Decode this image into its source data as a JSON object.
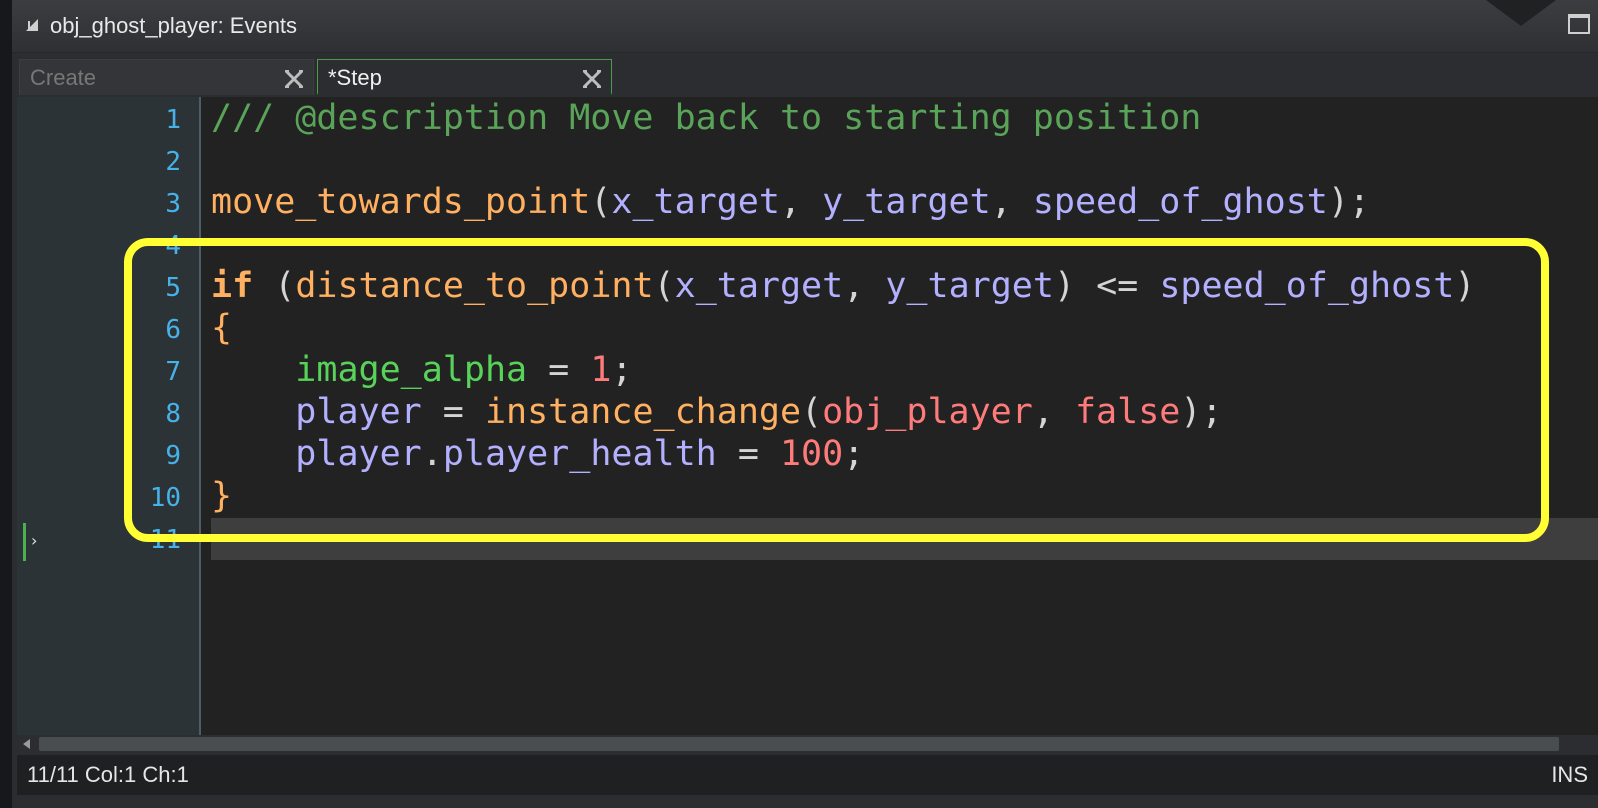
{
  "window": {
    "title": "obj_ghost_player: Events"
  },
  "tabs": [
    {
      "label": "Create",
      "active": false
    },
    {
      "label": "*Step",
      "active": true
    }
  ],
  "editor": {
    "line_numbers": [
      "1",
      "2",
      "3",
      "4",
      "5",
      "6",
      "7",
      "8",
      "9",
      "10",
      "11"
    ],
    "code": {
      "l1": "/// @description Move back to starting position",
      "l3_func": "move_towards_point",
      "l3_a": "x_target",
      "l3_b": "y_target",
      "l3_c": "speed_of_ghost",
      "l5_kw": "if",
      "l5_func": "distance_to_point",
      "l5_a": "x_target",
      "l5_b": "y_target",
      "l5_op": "<=",
      "l5_c": "speed_of_ghost",
      "l6": "{",
      "l7_var": "image_alpha",
      "l7_val": "1",
      "l8_var": "player",
      "l8_func": "instance_change",
      "l8_a": "obj_player",
      "l8_b": "false",
      "l9_obj": "player",
      "l9_prop": "player_health",
      "l9_val": "100",
      "l10": "}"
    },
    "highlight_color": "#ffff33"
  },
  "status": {
    "position": "11/11 Col:1 Ch:1",
    "mode": "INS"
  },
  "colors": {
    "comment": "#5aa45a",
    "function": "#ffb061",
    "variable": "#b3b0ff",
    "builtin": "#58d35a",
    "number": "#ff7b7b",
    "tab_active_border": "#4d9a4b",
    "line_number": "#46b2e8"
  }
}
